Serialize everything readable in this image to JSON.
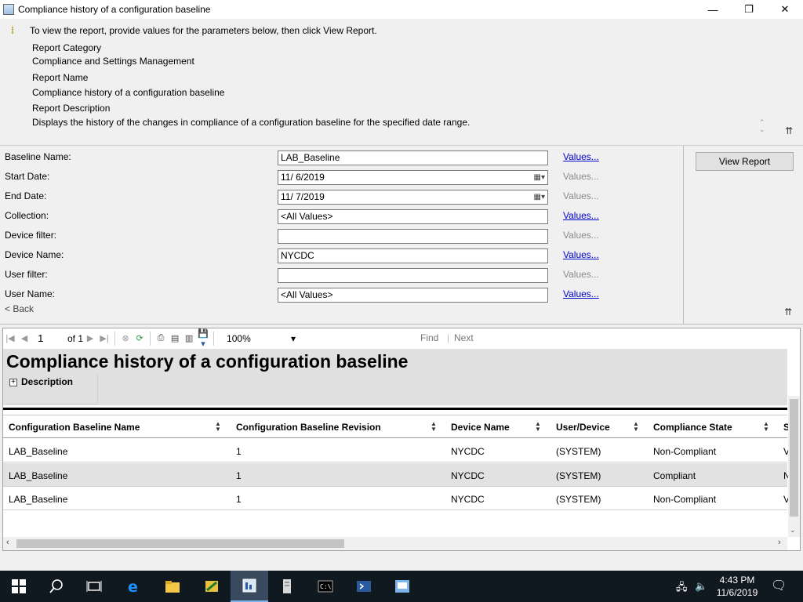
{
  "window": {
    "title": "Compliance history of a configuration baseline",
    "minimize": "—",
    "maximize": "❐",
    "close": "✕"
  },
  "info": {
    "hint": "To view the report, provide values for the parameters below, then click View Report.",
    "category_label": "Report Category",
    "category_value": "Compliance and Settings Management",
    "name_label": "Report Name",
    "name_value": "Compliance history of a configuration baseline",
    "desc_label": "Report Description",
    "desc_value": "Displays the history of the changes in compliance of a configuration baseline for the specified date range."
  },
  "params": {
    "rows": [
      {
        "label": "Baseline Name:",
        "value": "LAB_Baseline",
        "values": "Values...",
        "values_enabled": true,
        "calendar": false
      },
      {
        "label": "Start Date:",
        "value": "11/  6/2019",
        "values": "Values...",
        "values_enabled": false,
        "calendar": true
      },
      {
        "label": "End Date:",
        "value": "11/  7/2019",
        "values": "Values...",
        "values_enabled": false,
        "calendar": true
      },
      {
        "label": "Collection:",
        "value": "<All Values>",
        "values": "Values...",
        "values_enabled": true,
        "calendar": false
      },
      {
        "label": "Device filter:",
        "value": "",
        "values": "Values...",
        "values_enabled": false,
        "calendar": false
      },
      {
        "label": "Device Name:",
        "value": "NYCDC",
        "values": "Values...",
        "values_enabled": true,
        "calendar": false
      },
      {
        "label": "User filter:",
        "value": "",
        "values": "Values...",
        "values_enabled": false,
        "calendar": false
      },
      {
        "label": "User Name:",
        "value": "<All Values>",
        "values": "Values...",
        "values_enabled": true,
        "calendar": false
      }
    ],
    "back": "< Back",
    "view_report": "View Report"
  },
  "toolbar": {
    "page": "1",
    "of": "of",
    "total": "1",
    "zoom": "100%",
    "find": "Find",
    "sep": "|",
    "next": "Next"
  },
  "report": {
    "title": "Compliance history of a configuration baseline",
    "description_label": "Description",
    "columns": [
      "Configuration Baseline Name",
      "Configuration Baseline Revision",
      "Device Name",
      "User/Device",
      "Compliance State",
      "S"
    ],
    "rows": [
      [
        "LAB_Baseline",
        "1",
        "NYCDC",
        "(SYSTEM)",
        "Non-Compliant",
        "V"
      ],
      [
        "LAB_Baseline",
        "1",
        "NYCDC",
        "(SYSTEM)",
        "Compliant",
        "N"
      ],
      [
        "LAB_Baseline",
        "1",
        "NYCDC",
        "(SYSTEM)",
        "Non-Compliant",
        "V"
      ]
    ]
  },
  "taskbar": {
    "time": "4:43 PM",
    "date": "11/6/2019"
  }
}
